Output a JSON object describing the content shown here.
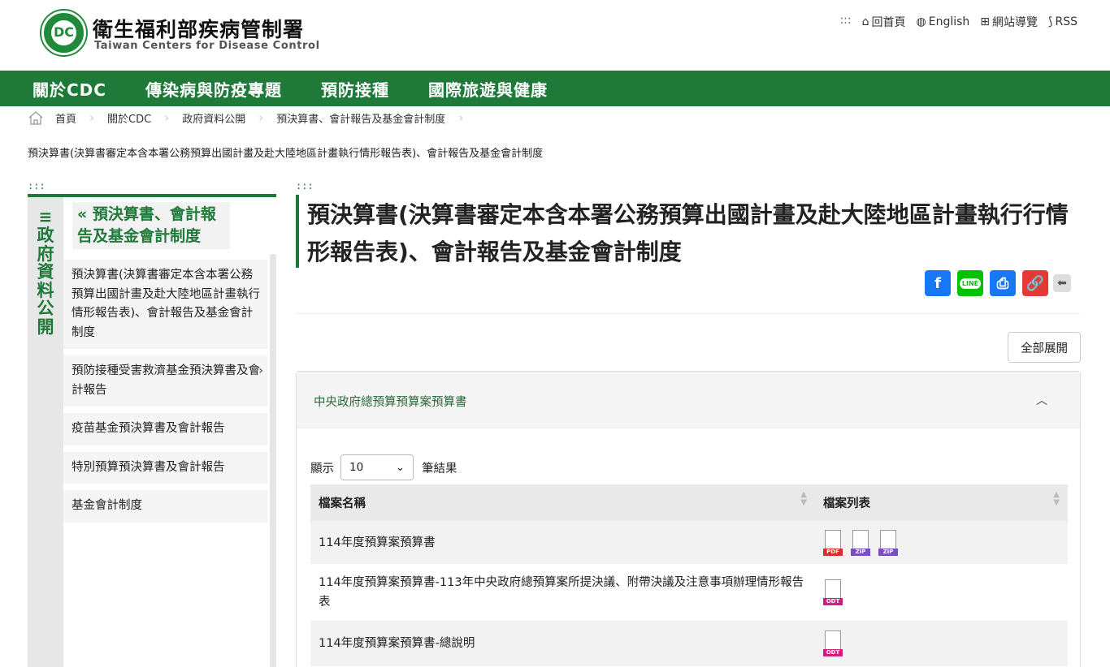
{
  "header": {
    "org_name": "衛生福利部疾病管制署",
    "org_name_en": "Taiwan Centers for Disease Control",
    "logo_letter": "DC",
    "toplinks": {
      "dots": ":::",
      "home": "回首頁",
      "english": "English",
      "sitemap": "網站導覽",
      "rss": "RSS"
    }
  },
  "nav": {
    "items": [
      "關於CDC",
      "傳染病與防疫專題",
      "預防接種",
      "國際旅遊與健康"
    ]
  },
  "breadcrumb": {
    "items": [
      "首頁",
      "關於CDC",
      "政府資料公開",
      "預決算書、會計報告及基金會計制度"
    ]
  },
  "page_subtitle": "預決算書(決算書審定本含本署公務預算出國計畫及赴大陸地區計畫執行情形報告表)、會計報告及基金會計制度",
  "accesskeys": {
    "left": ":::",
    "main": ":::"
  },
  "sidebar": {
    "vertical_title": "政府資料公開",
    "section_title": "« 預決算書、會計報告及基金會計制度",
    "items": [
      {
        "label": "預決算書(決算書審定本含本署公務預算出國計畫及赴大陸地區計畫執行情形報告表)、會計報告及基金會計制度",
        "has_arrow": false
      },
      {
        "label": "預防接種受害救濟基金預決算書及會計報告",
        "has_arrow": true
      },
      {
        "label": "疫苗基金預決算書及會計報告",
        "has_arrow": false
      },
      {
        "label": "特別預算預決算書及會計報告",
        "has_arrow": false
      },
      {
        "label": "基金會計制度",
        "has_arrow": false
      }
    ]
  },
  "main": {
    "title": "預決算書(決算書審定本含本署公務預算出國計畫及赴大陸地區計畫執行行情形報告表)、會計報告及基金會計制度",
    "share": {
      "facebook": "f",
      "line": "LINE",
      "print": "⎙",
      "link": "🔗",
      "back": "⬅"
    },
    "expand_all": "全部展開",
    "panel": {
      "title": "中央政府總預算預算案預算書",
      "caret": "︿",
      "show_prefix": "顯示",
      "page_size": "10",
      "show_suffix": "筆結果",
      "columns": [
        "檔案名稱",
        "檔案列表"
      ],
      "rows": [
        {
          "name": "114年度預算案預算書",
          "files": [
            "PDF",
            "ZIP",
            "ZIP"
          ]
        },
        {
          "name": "114年度預算案預算書-113年中央政府總預算案所提決議、附帶決議及注意事項辦理情形報告表",
          "files": [
            "ODT"
          ]
        },
        {
          "name": "114年度預算案預算書-總說明",
          "files": [
            "ODT"
          ]
        }
      ]
    }
  },
  "colors": {
    "brand_green": "#1f7a3a",
    "facebook": "#1877f2",
    "line": "#00c300",
    "link": "#e53935"
  }
}
